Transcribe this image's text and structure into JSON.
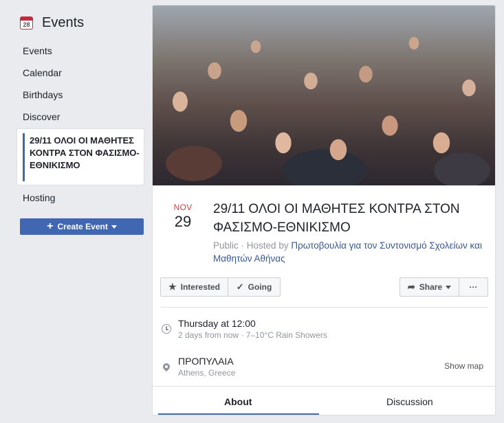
{
  "sidebar": {
    "title": "Events",
    "calendar_day": "28",
    "items": [
      {
        "label": "Events"
      },
      {
        "label": "Calendar"
      },
      {
        "label": "Birthdays"
      },
      {
        "label": "Discover"
      }
    ],
    "active_item": "29/11 ΟΛΟΙ ΟΙ ΜΑΘΗΤΕΣ ΚΟΝΤΡΑ ΣΤΟΝ ΦΑΣΙΣΜΟ-ΕΘΝΙΚΙΣΜΟ",
    "hosting": "Hosting",
    "create_event": "Create Event"
  },
  "event": {
    "month": "NOV",
    "day": "29",
    "title": "29/11 ΟΛΟΙ ΟΙ ΜΑΘΗΤΕΣ ΚΟΝΤΡΑ ΣΤΟΝ ΦΑΣΙΣΜΟ-ΕΘΝΙΚΙΣΜΟ",
    "visibility": "Public",
    "hosted_by_prefix": "· Hosted by",
    "host": "Πρωτοβουλία για τον Συντονισμό Σχολείων και Μαθητών Αθήνας"
  },
  "actions": {
    "interested": "Interested",
    "going": "Going",
    "share": "Share",
    "more": "···"
  },
  "details": {
    "time": "Thursday at 12:00",
    "time_sub": "2 days from now · 7–10°C Rain Showers",
    "location": "ΠΡΟΠΥΛΑΙΑ",
    "location_sub": "Athens, Greece",
    "show_map": "Show map"
  },
  "tabs": {
    "about": "About",
    "discussion": "Discussion"
  },
  "colors": {
    "accent": "#4267b2",
    "month_red": "#e0393e",
    "link": "#365899"
  }
}
